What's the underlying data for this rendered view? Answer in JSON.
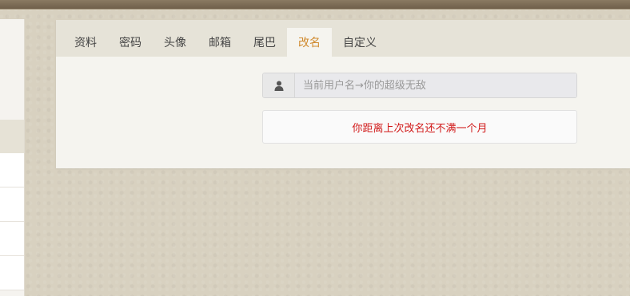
{
  "tabs": [
    {
      "label": "资料",
      "active": false
    },
    {
      "label": "密码",
      "active": false
    },
    {
      "label": "头像",
      "active": false
    },
    {
      "label": "邮箱",
      "active": false
    },
    {
      "label": "尾巴",
      "active": false
    },
    {
      "label": "改名",
      "active": true
    },
    {
      "label": "自定义",
      "active": false
    }
  ],
  "rename": {
    "input_icon": "user-icon",
    "placeholder": "当前用户名→你的超级无敌",
    "notice": "你距离上次改名还不满一个月"
  },
  "colors": {
    "active_tab": "#d08a2e",
    "notice_text": "#d11a1a",
    "top_bar": "#7a6a54"
  }
}
